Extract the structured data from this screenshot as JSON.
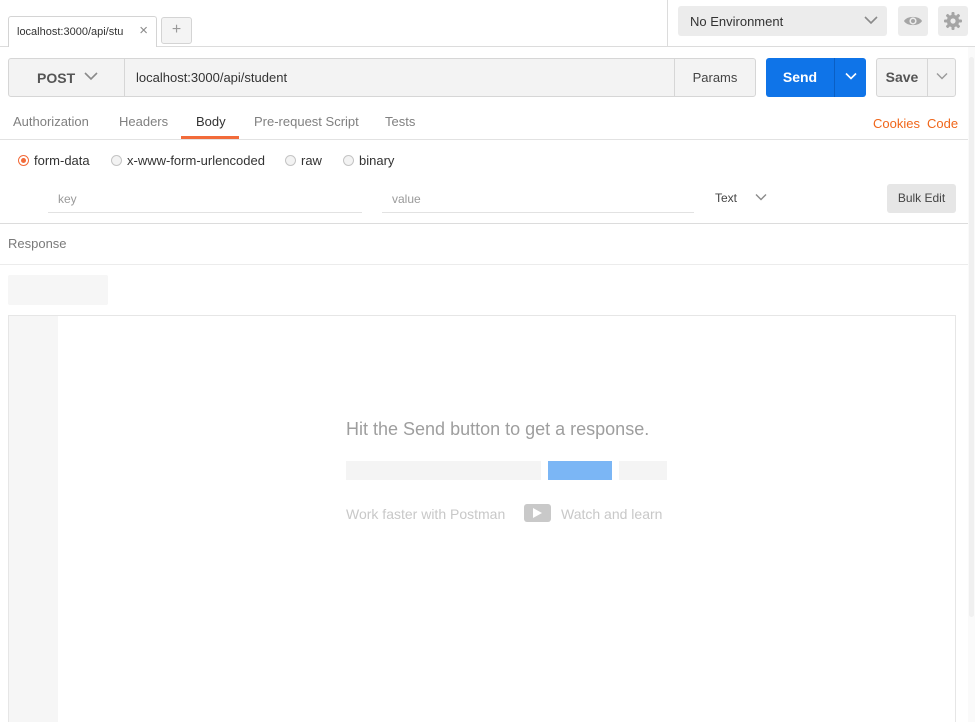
{
  "tabs": {
    "request_tab_label": "localhost:3000/api/stu",
    "close_glyph": "×",
    "new_tab_glyph": "+"
  },
  "environment": {
    "selected": "No Environment",
    "icons": [
      "eye-icon",
      "gear-icon"
    ]
  },
  "request": {
    "method": "POST",
    "url": "localhost:3000/api/student",
    "params_label": "Params",
    "send_label": "Send",
    "save_label": "Save"
  },
  "subtabs": {
    "items": [
      {
        "label": "Authorization"
      },
      {
        "label": "Headers"
      },
      {
        "label": "Body"
      },
      {
        "label": "Pre-request Script"
      },
      {
        "label": "Tests"
      }
    ],
    "active": "Body",
    "cookies_label": "Cookies",
    "code_label": "Code"
  },
  "body": {
    "types": [
      {
        "label": "form-data",
        "selected": true
      },
      {
        "label": "x-www-form-urlencoded",
        "selected": false
      },
      {
        "label": "raw",
        "selected": false
      },
      {
        "label": "binary",
        "selected": false
      }
    ],
    "key_placeholder": "key",
    "value_placeholder": "value",
    "type_label": "Text",
    "bulk_edit_label": "Bulk Edit"
  },
  "response": {
    "title": "Response",
    "hint": "Hit the Send button to get a response.",
    "learn_left": "Work faster with Postman",
    "learn_right": "Watch and learn"
  },
  "colors": {
    "accent": "#f26b3a",
    "send_blue": "#0f74e8",
    "link_orange": "#f0661a"
  }
}
